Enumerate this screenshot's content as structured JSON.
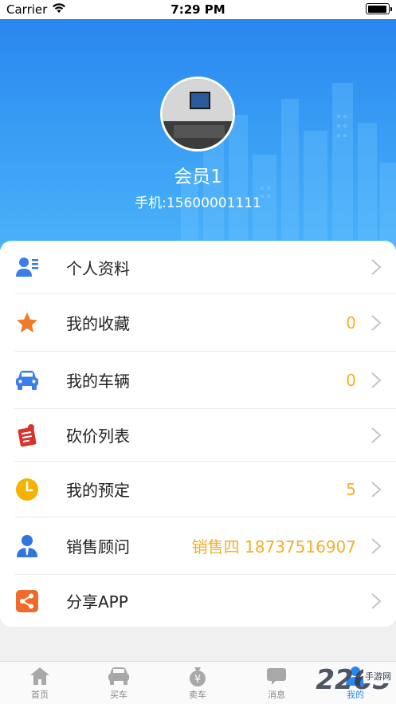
{
  "status_bar": {
    "carrier": "Carrier",
    "time": "7:29 PM",
    "battery_level": 0.95
  },
  "profile": {
    "name": "会员1",
    "phone": "手机:15600001111"
  },
  "menu": {
    "items": [
      {
        "label": "个人资料",
        "value": "",
        "icon": "profile-card-icon",
        "color": "#3a7ee6"
      },
      {
        "label": "我的收藏",
        "value": "0",
        "icon": "star-icon",
        "color": "#f07a2a"
      },
      {
        "label": "我的车辆",
        "value": "0",
        "icon": "car-icon",
        "color": "#3a7ee6"
      },
      {
        "label": "砍价列表",
        "value": "",
        "icon": "price-tag-list-icon",
        "color": "#d9342b"
      },
      {
        "label": "我的预定",
        "value": "5",
        "icon": "clock-icon",
        "color": "#f5b300"
      },
      {
        "label": "销售顾问",
        "value": "销售四 18737516907",
        "icon": "advisor-person-icon",
        "color": "#2f75e0"
      },
      {
        "label": "分享APP",
        "value": "",
        "icon": "share-icon",
        "color": "#f06a2a"
      }
    ]
  },
  "tabbar": {
    "tabs": [
      {
        "label": "首页",
        "icon": "home-icon",
        "active": false
      },
      {
        "label": "买车",
        "icon": "buy-car-icon",
        "active": false
      },
      {
        "label": "卖车",
        "icon": "sell-money-bag-icon",
        "active": false
      },
      {
        "label": "消息",
        "icon": "message-icon",
        "active": false
      },
      {
        "label": "我的",
        "icon": "me-person-icon",
        "active": true
      }
    ]
  },
  "watermark": {
    "text": "2265",
    "sub": "手游网"
  },
  "colors": {
    "header_top": "#2a86ef",
    "header_bottom": "#4ab2fa",
    "value_accent": "#f3b02a",
    "tab_active": "#2a86ef",
    "tab_inactive": "#9a9a9a"
  }
}
